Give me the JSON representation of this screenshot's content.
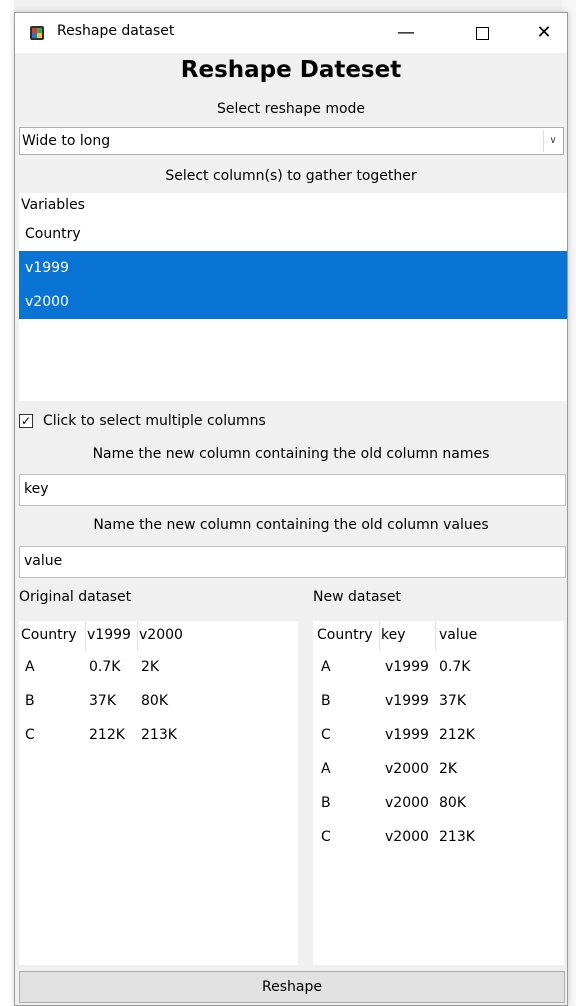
{
  "window": {
    "title": "Reshape dataset",
    "minimize_glyph": "—",
    "close_glyph": "✕"
  },
  "heading": "Reshape Dateset",
  "mode_label": "Select reshape mode",
  "mode_select": {
    "value": "Wide to long"
  },
  "gather_label": "Select column(s) to gather together",
  "variables": {
    "header": "Variables",
    "items": [
      {
        "label": "Country",
        "selected": false
      },
      {
        "label": "v1999",
        "selected": true
      },
      {
        "label": "v2000",
        "selected": true
      }
    ]
  },
  "multi_select": {
    "label": "Click to select multiple columns",
    "checked": true
  },
  "key_label": "Name the new column containing the old column names",
  "key_value": "key",
  "value_label": "Name the new column containing the old column values",
  "value_value": "value",
  "original": {
    "title": "Original dataset",
    "headers": [
      "Country",
      "v1999",
      "v2000"
    ],
    "rows": [
      [
        "A",
        "0.7K",
        "2K"
      ],
      [
        "B",
        "37K",
        "80K"
      ],
      [
        "C",
        "212K",
        "213K"
      ]
    ]
  },
  "new_dataset": {
    "title": "New dataset",
    "headers": [
      "Country",
      "key",
      "value"
    ],
    "rows": [
      [
        "A",
        "v1999",
        "0.7K"
      ],
      [
        "B",
        "v1999",
        "37K"
      ],
      [
        "C",
        "v1999",
        "212K"
      ],
      [
        "A",
        "v2000",
        "2K"
      ],
      [
        "B",
        "v2000",
        "80K"
      ],
      [
        "C",
        "v2000",
        "213K"
      ]
    ]
  },
  "reshape_button": "Reshape",
  "colors": {
    "selection": "#0a74d4",
    "window_bg": "#f0f0f0"
  }
}
